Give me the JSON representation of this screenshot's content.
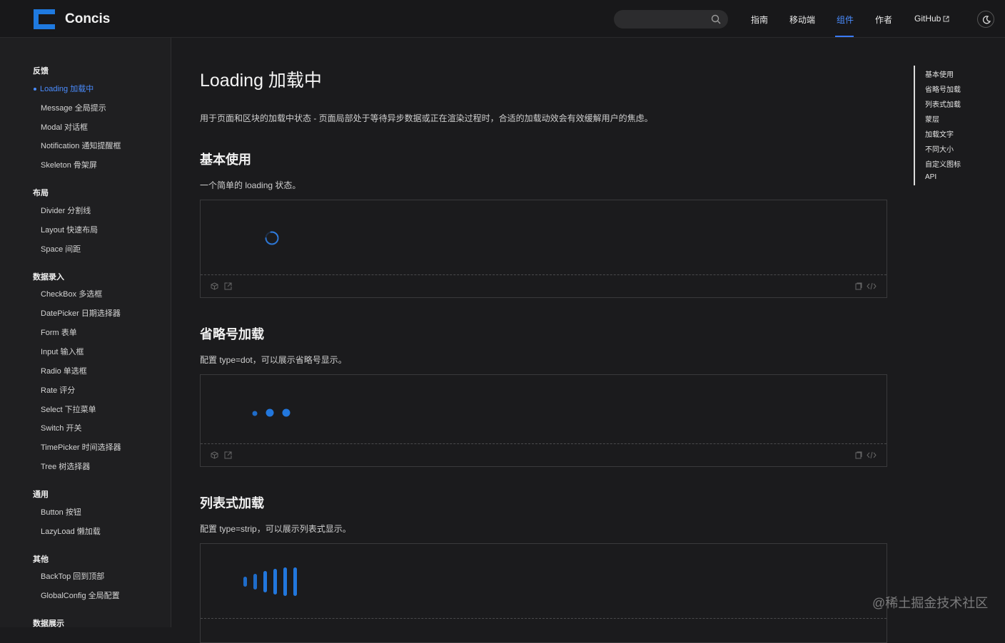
{
  "header": {
    "brand": "Concis",
    "search": {
      "placeholder": ""
    },
    "nav": [
      {
        "label": "指南"
      },
      {
        "label": "移动端"
      },
      {
        "label": "组件",
        "active": true
      },
      {
        "label": "作者"
      },
      {
        "label": "GitHub"
      }
    ],
    "icons": {
      "search": "search-icon",
      "theme": "moon-icon",
      "external": "external-link-icon"
    },
    "accent": "#4a8cff"
  },
  "sidebar": {
    "groups": [
      {
        "title": "反馈",
        "items": [
          "Loading 加载中",
          "Message 全局提示",
          "Modal 对话框",
          "Notification 通知提醒框",
          "Skeleton 骨架屏"
        ],
        "active_index": 0
      },
      {
        "title": "布局",
        "items": [
          "Divider 分割线",
          "Layout 快速布局",
          "Space 间距"
        ]
      },
      {
        "title": "数据录入",
        "items": [
          "CheckBox 多选框",
          "DatePicker 日期选择器",
          "Form 表单",
          "Input 输入框",
          "Radio 单选框",
          "Rate 评分",
          "Select 下拉菜单",
          "Switch 开关",
          "TimePicker 时间选择器",
          "Tree 树选择器"
        ]
      },
      {
        "title": "通用",
        "items": [
          "Button 按钮",
          "LazyLoad 懒加载"
        ]
      },
      {
        "title": "其他",
        "items": [
          "BackTop 回到顶部",
          "GlobalConfig 全局配置"
        ]
      },
      {
        "title": "数据展示",
        "items": []
      }
    ]
  },
  "main": {
    "title": "Loading 加载中",
    "intro": "用于页面和区块的加载中状态 - 页面局部处于等待异步数据或正在渲染过程时，合适的加载动效会有效缓解用户的焦虑。",
    "sections": [
      {
        "heading": "基本使用",
        "desc": "一个简单的 loading 状态。",
        "demo": "spinner"
      },
      {
        "heading": "省略号加载",
        "desc": "配置 type=dot，可以展示省略号显示。",
        "demo": "dot"
      },
      {
        "heading": "列表式加载",
        "desc": "配置 type=strip，可以展示列表式显示。",
        "demo": "strip"
      }
    ],
    "toolbar_icons": [
      "codesandbox-icon",
      "open-external-icon",
      "copy-icon",
      "code-icon"
    ]
  },
  "toc": [
    "基本使用",
    "省略号加载",
    "列表式加载",
    "蒙层",
    "加载文字",
    "不同大小",
    "自定义图标",
    "API"
  ],
  "watermark": "@稀土掘金技术社区"
}
